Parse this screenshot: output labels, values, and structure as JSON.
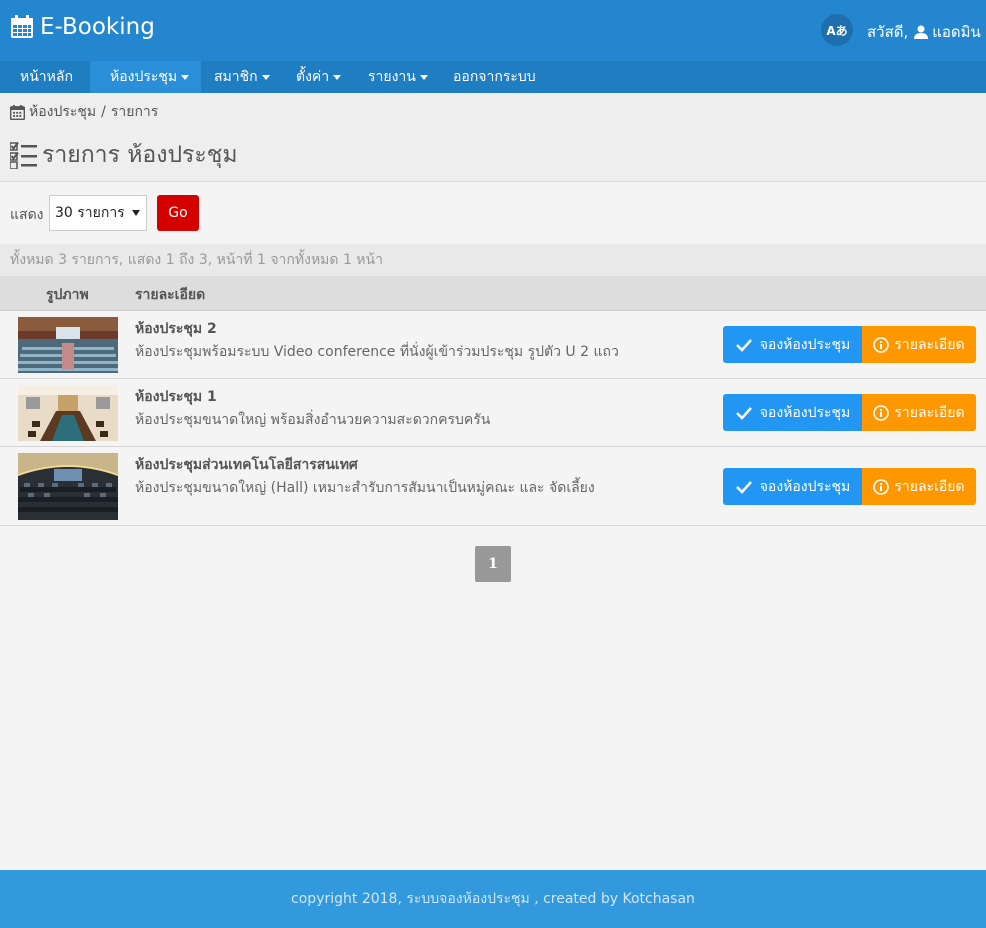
{
  "app": {
    "title": "E-Booking",
    "icon": "calendar-icon"
  },
  "header": {
    "lang_label": "Aあ",
    "greeting": "สวัสดี,",
    "user": "แอดมิน"
  },
  "nav": {
    "items": [
      {
        "label": "หน้าหลัก",
        "dropdown": false
      },
      {
        "label": "ห้องประชุม",
        "dropdown": true,
        "active": true
      },
      {
        "label": "สมาชิก",
        "dropdown": true
      },
      {
        "label": "ตั้งค่า",
        "dropdown": true
      },
      {
        "label": "รายงาน",
        "dropdown": true
      },
      {
        "label": "ออกจากระบบ",
        "dropdown": false
      }
    ]
  },
  "breadcrumb": {
    "parent": "ห้องประชุม",
    "separator": "/",
    "current": "รายการ"
  },
  "page": {
    "title": "รายการ ห้องประชุม"
  },
  "filter": {
    "show_label": "แสดง",
    "per_page": "30 รายการ",
    "go_label": "Go"
  },
  "summary": "ทั้งหมด 3 รายการ, แสดง 1 ถึง 3, หน้าที่ 1 จากทั้งหมด 1 หน้า",
  "table": {
    "headers": {
      "image": "รูปภาพ",
      "detail": "รายละเอียด"
    },
    "rows": [
      {
        "title": "ห้องประชุม 2",
        "desc": "ห้องประชุมพร้อมระบบ Video conference ที่นั่งผู้เข้าร่วมประชุม รูปตัว U 2 แถว",
        "book": "จองห้องประชุม",
        "detail": "รายละเอียด"
      },
      {
        "title": "ห้องประชุม 1",
        "desc": "ห้องประชุมขนาดใหญ่ พร้อมสิ่งอำนวยความสะดวกครบครัน",
        "book": "จองห้องประชุม",
        "detail": "รายละเอียด"
      },
      {
        "title": "ห้องประชุมส่วนเทคโนโลยีสารสนเทศ",
        "desc": "ห้องประชุมขนาดใหญ่ (Hall) เหมาะสำรับการสัมนาเป็นหมู่คณะ และ จัดเลี้ยง",
        "book": "จองห้องประชุม",
        "detail": "รายละเอียด"
      }
    ]
  },
  "pagination": {
    "current": "1"
  },
  "footer": "copyright 2018, ระบบจองห้องประชุม , created by Kotchasan",
  "colors": {
    "header": "#2486cf",
    "nav": "#1f7dc2",
    "book": "#2196f3",
    "detail": "#ff9800",
    "go": "#d40000",
    "footer": "#3399dd"
  }
}
